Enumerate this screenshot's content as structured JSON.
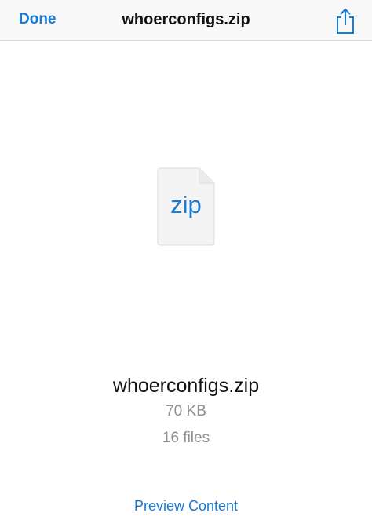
{
  "navbar": {
    "done_label": "Done",
    "title": "whoerconfigs.zip",
    "share_icon": "share-icon"
  },
  "file": {
    "icon": "zip-document-icon",
    "extension": "zip",
    "name": "whoerconfigs.zip",
    "size": "70 KB",
    "count": "16 files"
  },
  "actions": {
    "preview_label": "Preview Content"
  },
  "colors": {
    "accent": "#1a7ad4",
    "secondary_text": "#8e8e93",
    "navbar_bg": "#f8f8f8"
  }
}
